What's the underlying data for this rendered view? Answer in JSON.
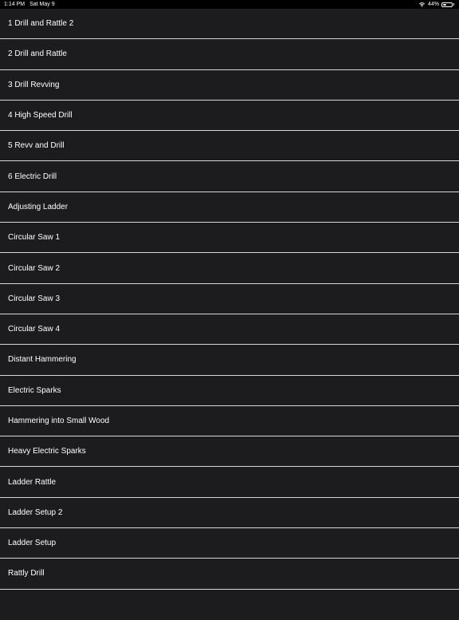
{
  "status": {
    "time": "1:14 PM",
    "date": "Sat May 9",
    "battery": "44%",
    "battery_level": 0.44,
    "icons": [
      "wifi-icon",
      "battery-icon"
    ]
  },
  "colors": {
    "background": "#000000",
    "row_background": "#1c1c1e",
    "separator": "#d8d8d8",
    "text": "#ffffff"
  },
  "items": [
    {
      "label": "1 Drill and Rattle 2"
    },
    {
      "label": "2 Drill and Rattle"
    },
    {
      "label": "3 Drill Revving"
    },
    {
      "label": "4 High Speed Drill"
    },
    {
      "label": "5 Revv and Drill"
    },
    {
      "label": "6 Electric Drill"
    },
    {
      "label": "Adjusting Ladder"
    },
    {
      "label": "Circular Saw 1"
    },
    {
      "label": "Circular Saw 2"
    },
    {
      "label": "Circular Saw 3"
    },
    {
      "label": "Circular Saw 4"
    },
    {
      "label": "Distant Hammering"
    },
    {
      "label": "Electric Sparks"
    },
    {
      "label": "Hammering into Small Wood"
    },
    {
      "label": "Heavy Electric Sparks"
    },
    {
      "label": "Ladder Rattle"
    },
    {
      "label": "Ladder Setup 2"
    },
    {
      "label": "Ladder Setup"
    },
    {
      "label": "Rattly Drill"
    }
  ]
}
